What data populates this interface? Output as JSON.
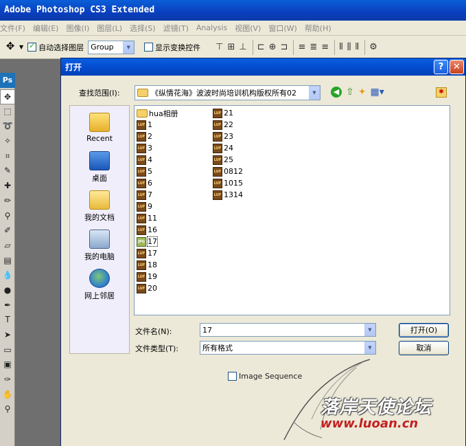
{
  "app": {
    "title": "Adobe Photoshop CS3 Extended",
    "menu": [
      "文件(F)",
      "编辑(E)",
      "图像(I)",
      "图层(L)",
      "选择(S)",
      "滤镜(T)",
      "Analysis",
      "视图(V)",
      "窗口(W)",
      "帮助(H)"
    ],
    "options": {
      "auto_select_label": "自动选择图层",
      "auto_select_checked": true,
      "group_value": "Group",
      "show_transform_label": "显示变换控件",
      "show_transform_checked": false
    },
    "toolbox_logo": "Ps"
  },
  "dialog": {
    "title": "打开",
    "lookin_label": "查找范围(I):",
    "lookin_value": "《纵情花海》波波时尚培训机构版权所有02",
    "places": [
      {
        "label": "Recent",
        "icon": "recent-icon"
      },
      {
        "label": "桌面",
        "icon": "desktop-icon"
      },
      {
        "label": "我的文档",
        "icon": "my-documents-icon"
      },
      {
        "label": "我的电脑",
        "icon": "my-computer-icon"
      },
      {
        "label": "网上邻居",
        "icon": "network-icon"
      }
    ],
    "files_col1": [
      {
        "name": "hua相册",
        "type": "folder"
      },
      {
        "name": "1",
        "type": "luf"
      },
      {
        "name": "2",
        "type": "luf"
      },
      {
        "name": "3",
        "type": "luf"
      },
      {
        "name": "4",
        "type": "luf"
      },
      {
        "name": "5",
        "type": "luf"
      },
      {
        "name": "6",
        "type": "luf"
      },
      {
        "name": "7",
        "type": "luf"
      },
      {
        "name": "9",
        "type": "luf"
      },
      {
        "name": "11",
        "type": "luf"
      },
      {
        "name": "16",
        "type": "luf"
      },
      {
        "name": "17",
        "type": "jpg"
      },
      {
        "name": "17",
        "type": "luf"
      },
      {
        "name": "18",
        "type": "luf"
      },
      {
        "name": "19",
        "type": "luf"
      },
      {
        "name": "20",
        "type": "luf"
      }
    ],
    "files_col2": [
      {
        "name": "21",
        "type": "luf"
      },
      {
        "name": "22",
        "type": "luf"
      },
      {
        "name": "23",
        "type": "luf"
      },
      {
        "name": "24",
        "type": "luf"
      },
      {
        "name": "25",
        "type": "luf"
      },
      {
        "name": "0812",
        "type": "luf"
      },
      {
        "name": "1015",
        "type": "luf"
      },
      {
        "name": "1314",
        "type": "luf"
      }
    ],
    "filename_label": "文件名(N):",
    "filename_value": "17",
    "filetype_label": "文件类型(T):",
    "filetype_value": "所有格式",
    "open_button": "打开(O)",
    "cancel_button": "取消",
    "image_sequence_label": "Image Sequence",
    "image_sequence_checked": false
  },
  "watermark": {
    "text": "落岸天使论坛",
    "url": "www.luoan.cn"
  },
  "colors": {
    "titlebar_blue": "#0450d4",
    "dialog_bg": "#ece9d8",
    "workspace_gray": "#6f6f6f"
  }
}
